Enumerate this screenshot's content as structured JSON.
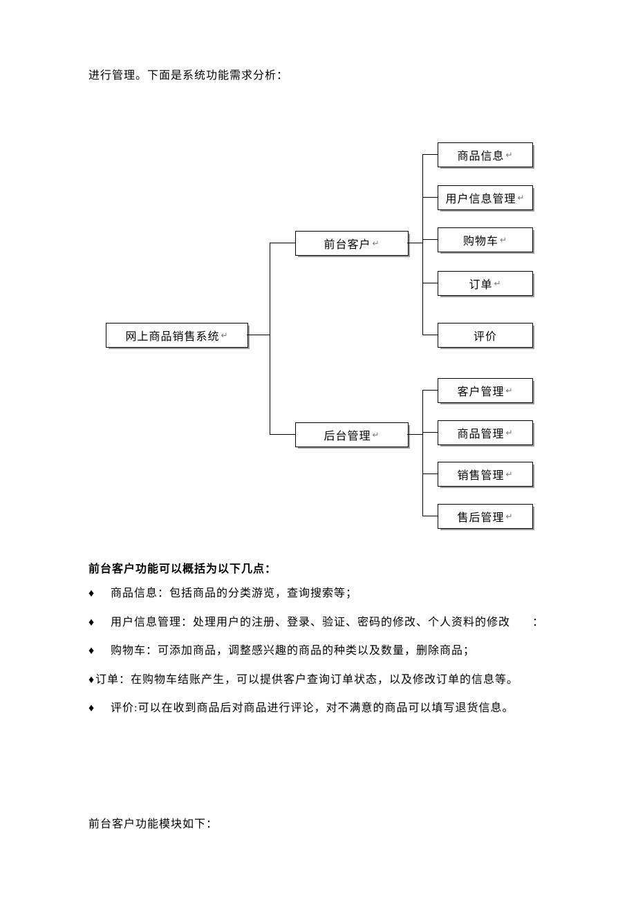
{
  "intro": "进行管理。下面是系统功能需求分析：",
  "diagram": {
    "root": "网上商品销售系统",
    "branches": [
      {
        "label": "前台客户",
        "children": [
          "商品信息",
          "用户信息管理",
          "购物车",
          "订单",
          "评价"
        ]
      },
      {
        "label": "后台管理",
        "children": [
          "客户管理",
          "商品管理",
          "销售管理",
          "售后管理"
        ]
      }
    ]
  },
  "section_title": "前台客户功能可以概括为以下几点：",
  "bullets": [
    "商品信息：包括商品的分类游览，查询搜索等；",
    "用户信息管理：处理用户的注册、登录、验证、密码的修改、个人资料的修改",
    "购物车：可添加商品，调整感兴趣的商品的种类以及数量，删除商品；",
    "订单：在购物车结账产生，可以提供客户查询订单状态，以及修改订单的信息等。",
    "评价:可以在收到商品后对商品进行评论，对不满意的商品可以填写退货信息。"
  ],
  "bullet2_tail": "：",
  "footer": "前台客户功能模块如下：",
  "chart_data": {
    "type": "tree",
    "title": "",
    "root": "网上商品销售系统",
    "children": [
      {
        "name": "前台客户",
        "children": [
          "商品信息",
          "用户信息管理",
          "购物车",
          "订单",
          "评价"
        ]
      },
      {
        "name": "后台管理",
        "children": [
          "客户管理",
          "商品管理",
          "销售管理",
          "售后管理"
        ]
      }
    ]
  }
}
